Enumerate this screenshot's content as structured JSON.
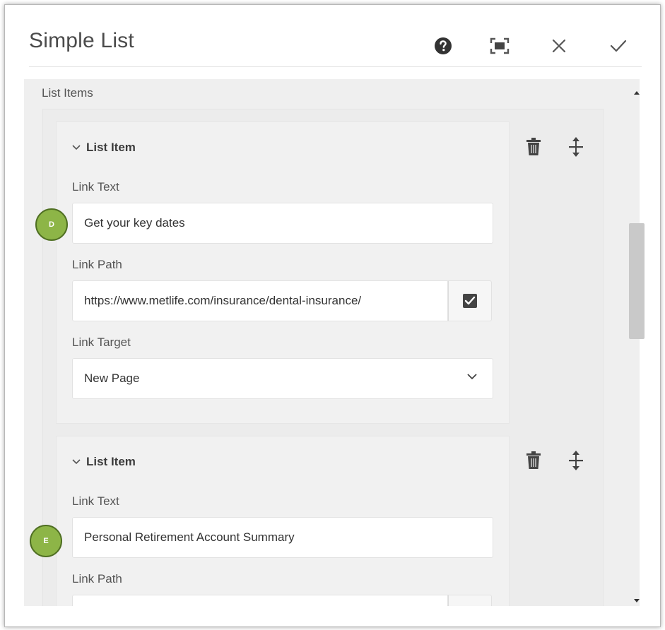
{
  "dialog": {
    "title": "Simple List",
    "help_icon": "help-icon",
    "fullscreen_icon": "fullscreen-icon",
    "close_icon": "close-icon",
    "confirm_icon": "check-icon"
  },
  "list": {
    "section_label": "List Items",
    "items": [
      {
        "header": "List Item",
        "link_text_label": "Link Text",
        "link_text_value": "Get your key dates",
        "link_path_label": "Link Path",
        "link_path_value": "https://www.metlife.com/insurance/dental-insurance/",
        "link_target_label": "Link Target",
        "link_target_value": "New Page",
        "marker": "D"
      },
      {
        "header": "List Item",
        "link_text_label": "Link Text",
        "link_text_value": "Personal Retirement Account Summary",
        "link_path_label": "Link Path",
        "link_path_value": "",
        "marker": "E"
      }
    ]
  },
  "colors": {
    "marker_fill": "#8db547",
    "marker_border": "#4f6f22",
    "panel_bg": "#efefef"
  }
}
